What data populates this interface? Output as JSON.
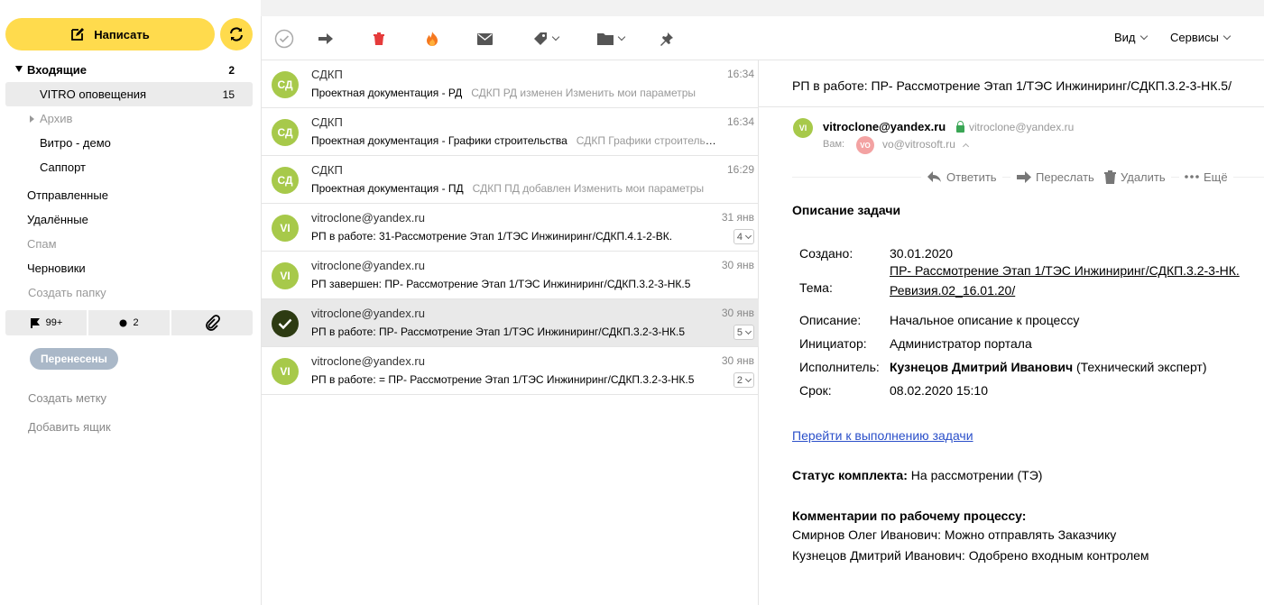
{
  "sidebar": {
    "compose_label": "Написать",
    "folders": [
      {
        "label": "Входящие",
        "count": "2"
      },
      {
        "label": "VITRO оповещения",
        "count": "15"
      },
      {
        "label": "Архив",
        "count": ""
      },
      {
        "label": "Витро - демо",
        "count": ""
      },
      {
        "label": "Саппорт",
        "count": ""
      },
      {
        "label": "Отправленные",
        "count": ""
      },
      {
        "label": "Удалённые",
        "count": ""
      },
      {
        "label": "Спам",
        "count": ""
      },
      {
        "label": "Черновики",
        "count": ""
      },
      {
        "label": "Создать папку",
        "count": ""
      }
    ],
    "filters": {
      "flagged": "99+",
      "unread": "2"
    },
    "label_badge": "Перенесены",
    "create_label": "Создать метку",
    "add_mailbox": "Добавить ящик"
  },
  "toolbar": {
    "view_label": "Вид",
    "services_label": "Сервисы"
  },
  "messages": [
    {
      "avatar": "СД",
      "from": "СДКП",
      "date": "16:34",
      "subject": "Проектная документация - РД",
      "snippet": "СДКП РД изменен Изменить мои параметры",
      "thread": ""
    },
    {
      "avatar": "СД",
      "from": "СДКП",
      "date": "16:34",
      "subject": "Проектная документация - Графики строительства",
      "snippet": "СДКП Графики строительства",
      "thread": ""
    },
    {
      "avatar": "СД",
      "from": "СДКП",
      "date": "16:29",
      "subject": "Проектная документация - ПД",
      "snippet": "СДКП ПД добавлен Изменить мои параметры",
      "thread": ""
    },
    {
      "avatar": "VI",
      "from": "vitroclone@yandex.ru",
      "date": "31 янв",
      "subject": "РП в работе: 31-Рассмотрение Этап 1/ТЭС Инжиниринг/СДКП.4.1-2-ВК.",
      "snippet": "",
      "thread": "4"
    },
    {
      "avatar": "VI",
      "from": "vitroclone@yandex.ru",
      "date": "30 янв",
      "subject": "РП завершен: ПР- Рассмотрение Этап 1/ТЭС Инжиниринг/СДКП.3.2-3-НК.5",
      "snippet": "",
      "thread": ""
    },
    {
      "avatar": "",
      "from": "vitroclone@yandex.ru",
      "date": "30 янв",
      "subject": "РП в работе: ПР- Рассмотрение Этап 1/ТЭС Инжиниринг/СДКП.3.2-3-НК.5",
      "snippet": "",
      "thread": "5"
    },
    {
      "avatar": "VI",
      "from": "vitroclone@yandex.ru",
      "date": "30 янв",
      "subject": "РП в работе: = ПР- Рассмотрение Этап 1/ТЭС Инжиниринг/СДКП.3.2-3-НК.5",
      "snippet": "",
      "thread": "2"
    }
  ],
  "reader": {
    "subject": "РП в работе: ПР- Рассмотрение Этап 1/ТЭС Инжиниринг/СДКП.3.2-3-НК.5/",
    "sender_avatar": "VI",
    "sender_name": "vitroclone@yandex.ru",
    "sender_addr": "vitroclone@yandex.ru",
    "to_label": "Вам:",
    "to_avatar": "VO",
    "to_addr": "vo@vitrosoft.ru",
    "actions": {
      "reply": "Ответить",
      "forward": "Переслать",
      "delete": "Удалить",
      "more": "Ещё"
    },
    "body_title": "Описание задачи",
    "fields": {
      "created_k": "Создано:",
      "created_v": "30.01.2020",
      "topic_k": "Тема:",
      "topic_v1": "ПР- Рассмотрение Этап 1/ТЭС Инжиниринг/СДКП.3.2-3-НК.",
      "topic_v2": "Ревизия.02_16.01.20/",
      "desc_k": "Описание:",
      "desc_v": "Начальное описание к процессу",
      "initiator_k": "Инициатор:",
      "initiator_v": "Администратор портала",
      "executor_k": "Исполнитель:",
      "executor_name": "Кузнецов Дмитрий Иванович",
      "executor_role": "(Технический эксперт)",
      "deadline_k": "Срок:",
      "deadline_v": "08.02.2020 15:10"
    },
    "goto_link": "Перейти к выполнению задачи",
    "status_label": "Статус комплекта:",
    "status_value": "На рассмотрении (ТЭ)",
    "comments_title": "Комментарии по рабочему процессу:",
    "comments": [
      "Смирнов Олег Иванович: Можно отправлять Заказчику",
      "Кузнецов Дмитрий Иванович: Одобрено входным контролем"
    ]
  }
}
